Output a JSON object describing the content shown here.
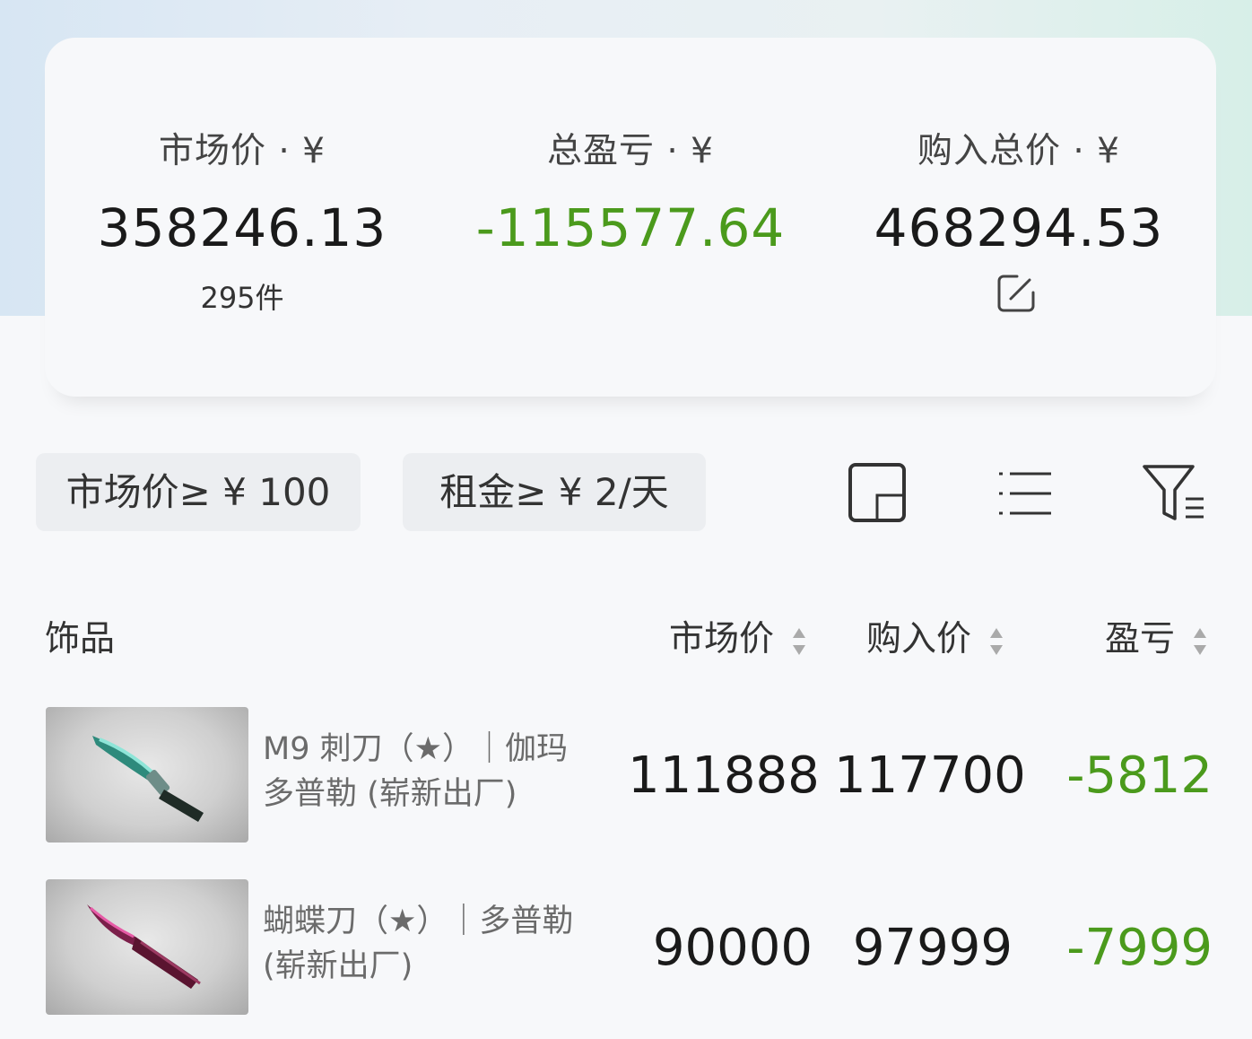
{
  "summary": {
    "market_value": {
      "label": "市场价 · ¥",
      "value": "358246.13",
      "count": "295件"
    },
    "total_pnl": {
      "label": "总盈亏 · ¥",
      "value": "-115577.64"
    },
    "purchase_total": {
      "label": "购入总价 · ¥",
      "value": "468294.53"
    }
  },
  "filters": [
    {
      "label": "市场价≥ ¥ 100"
    },
    {
      "label": "租金≥ ¥ 2/天"
    }
  ],
  "table": {
    "headers": {
      "item": "饰品",
      "market": "市场价",
      "purchase": "购入价",
      "pnl": "盈亏"
    },
    "rows": [
      {
        "name_line1": "M9 刺刀（★）｜伽玛",
        "name_line2": "多普勒 (崭新出厂)",
        "market": "111888",
        "purchase": "117700",
        "pnl": "-5812"
      },
      {
        "name_line1": "蝴蝶刀（★）｜多普勒",
        "name_line2": "(崭新出厂)",
        "market": "90000",
        "purchase": "97999",
        "pnl": "-7999"
      }
    ]
  },
  "colors": {
    "negative": "#4b9a1c"
  },
  "icons": [
    "edit-icon",
    "card-view-icon",
    "list-view-icon",
    "filter-icon",
    "sort-arrows-icon"
  ]
}
